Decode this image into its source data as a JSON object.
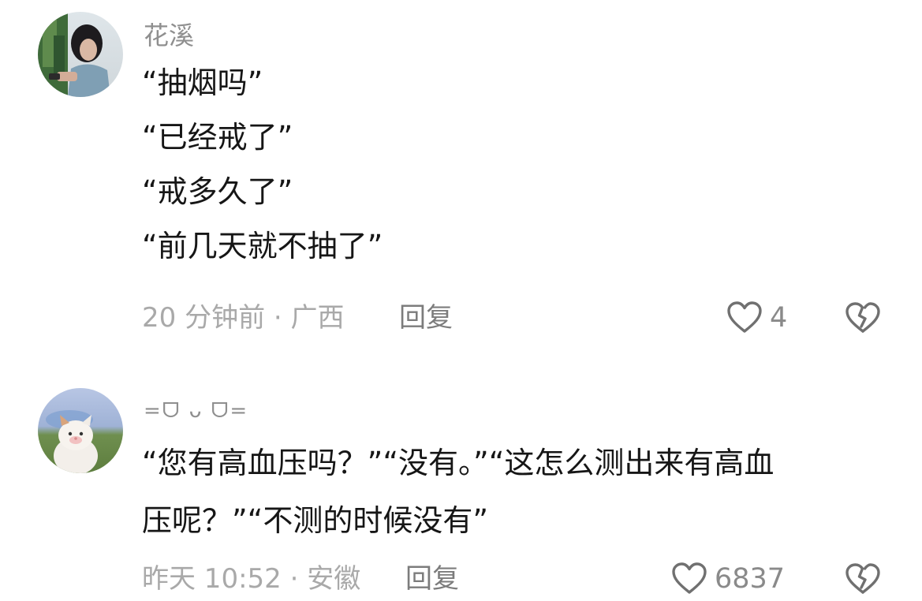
{
  "comments": [
    {
      "username": "花溪",
      "lines": [
        "“抽烟吗”",
        "“已经戒了”",
        "“戒多久了”",
        "“前几天就不抽了”"
      ],
      "meta": "20 分钟前 · 广西",
      "reply_label": "回复",
      "likes": "4",
      "avatar": "woman-photo-avatar"
    },
    {
      "username": "=ᗜ ᴗ ᗜ=",
      "lines": [
        "“您有高血压吗？”“没有。”“这怎么测出来有高血",
        "压呢？”“不测的时候没有”"
      ],
      "meta": "昨天 10:52 · 安徽",
      "reply_label": "回复",
      "likes": "6837",
      "avatar": "cat-photo-avatar"
    }
  ],
  "icons": {
    "like": "heart-outline-icon",
    "dislike": "broken-heart-icon"
  },
  "colors": {
    "text": "#161616",
    "username": "#8f8f8f",
    "meta": "#a9a9a9",
    "icon": "#707070"
  }
}
